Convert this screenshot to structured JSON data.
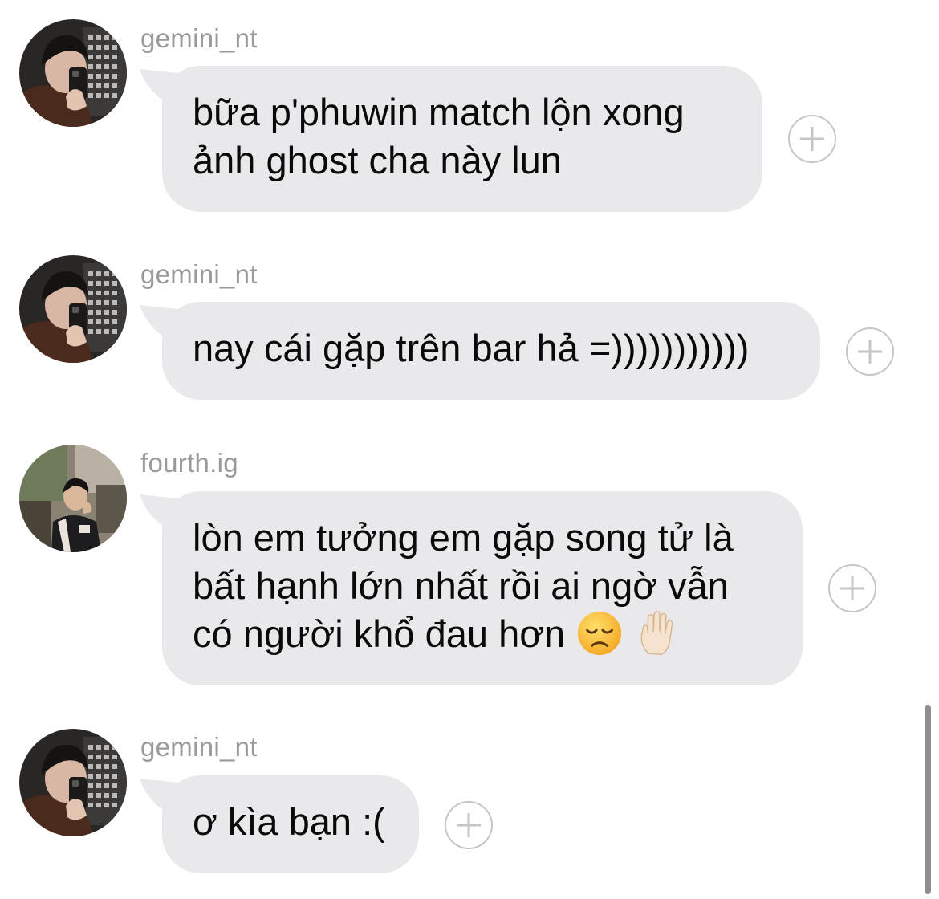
{
  "messages": [
    {
      "sender": "gemini_nt",
      "avatar": "avatar-gemini",
      "lines": [
        "bữa p'phuwin match lộn xong",
        "ảnh ghost cha này lun"
      ]
    },
    {
      "sender": "gemini_nt",
      "avatar": "avatar-gemini",
      "lines": [
        "nay cái gặp trên bar hả =)))))))))))"
      ]
    },
    {
      "sender": "fourth.ig",
      "avatar": "avatar-fourth",
      "lines": [
        "lòn em tưởng em gặp song tử là",
        "bất hạnh lớn nhất rồi ai ngờ vẫn",
        "có người khổ đau hơn"
      ],
      "emojis": [
        "disappointed-face-emoji",
        "raised-hand-light-skin-emoji"
      ]
    },
    {
      "sender": "gemini_nt",
      "avatar": "avatar-gemini",
      "lines": [
        "ơ kìa bạn :("
      ]
    }
  ],
  "icons": {
    "react": "add-reaction-icon"
  },
  "colors": {
    "bubble": "#e9e9eb",
    "sender_text": "#9a9a9e",
    "message_text": "#0a0a0a",
    "react_outline": "#c6c6c8"
  }
}
